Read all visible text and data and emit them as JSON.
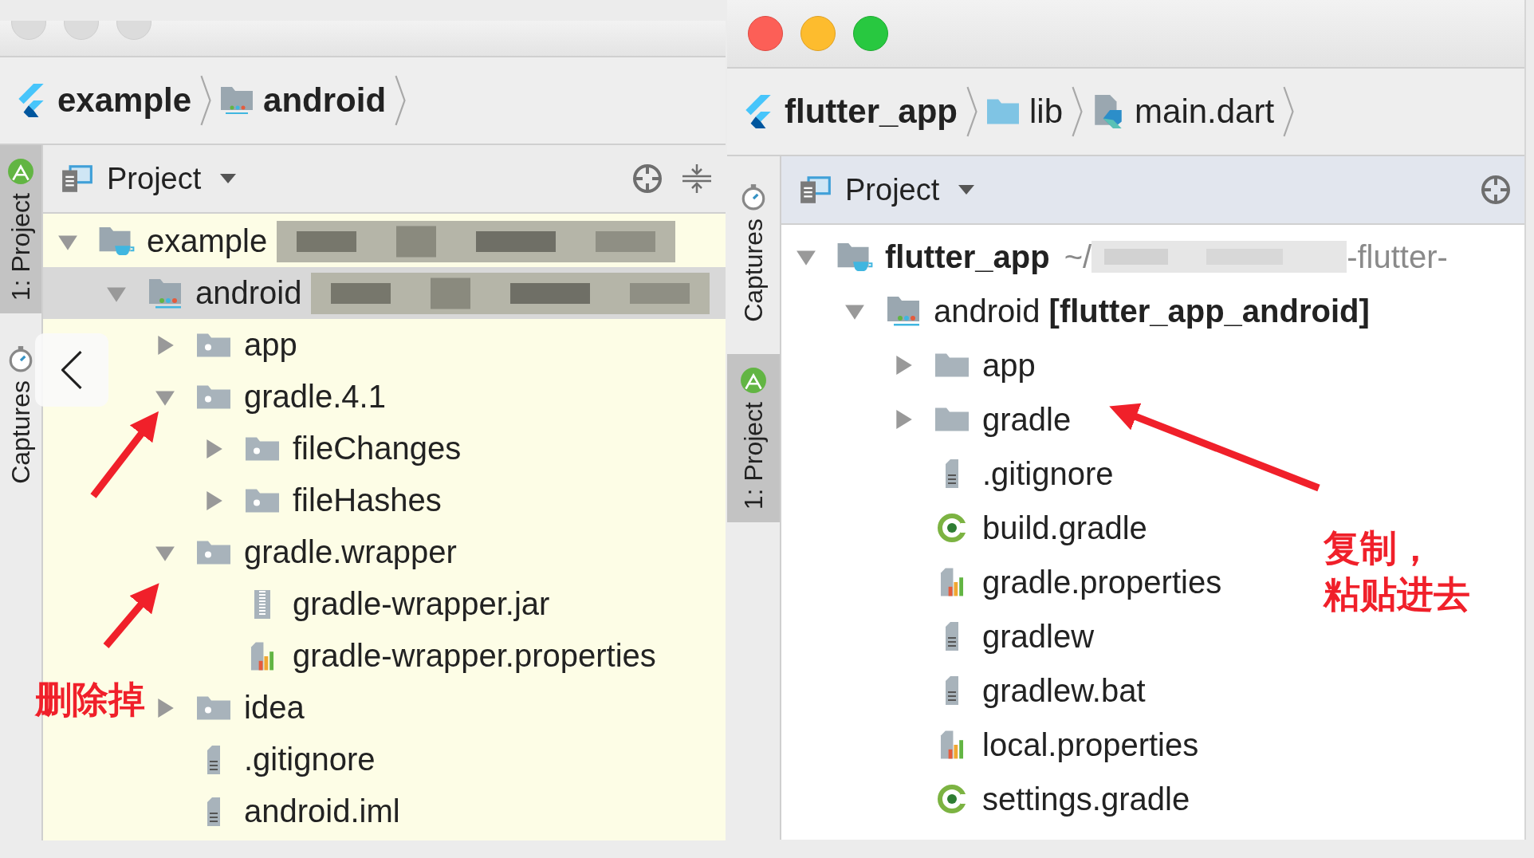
{
  "windows": [
    {
      "traffic_lights_active": false,
      "focused": false,
      "breadcrumbs": [
        {
          "label": "example",
          "kind": "flutter",
          "bold": true
        },
        {
          "label": "android",
          "kind": "module",
          "bold": true
        }
      ],
      "tool_tabs": [
        {
          "label": "1: Project",
          "kind": "android",
          "selected": true
        },
        {
          "label": "Captures",
          "kind": "captures",
          "selected": false
        }
      ],
      "panel": {
        "title": "Project",
        "tools": [
          {
            "kind": "locate"
          },
          {
            "kind": "collapse"
          }
        ]
      },
      "tree": [
        {
          "label": "example",
          "kind": "app-module",
          "redacted": true,
          "expanded": true,
          "selected": false,
          "children": [
            {
              "label": "android",
              "kind": "module",
              "redacted": true,
              "expanded": true,
              "selected": true,
              "children": [
                {
                  "label": "app",
                  "kind": "excluded-folder",
                  "expanded": false,
                  "selected": false
                },
                {
                  "label": "gradle.4.1",
                  "kind": "excluded-folder",
                  "expanded": true,
                  "selected": false,
                  "children": [
                    {
                      "label": "fileChanges",
                      "kind": "excluded-folder",
                      "expanded": false,
                      "selected": false
                    },
                    {
                      "label": "fileHashes",
                      "kind": "excluded-folder",
                      "expanded": false,
                      "selected": false
                    }
                  ]
                },
                {
                  "label": "gradle.wrapper",
                  "kind": "excluded-folder",
                  "expanded": true,
                  "selected": false,
                  "children": [
                    {
                      "label": "gradle-wrapper.jar",
                      "kind": "jar",
                      "selected": false
                    },
                    {
                      "label": "gradle-wrapper.properties",
                      "kind": "properties",
                      "selected": false
                    }
                  ]
                },
                {
                  "label": "idea",
                  "kind": "excluded-folder",
                  "expanded": false,
                  "selected": false
                },
                {
                  "label": ".gitignore",
                  "kind": "text",
                  "selected": false
                },
                {
                  "label": "android.iml",
                  "kind": "text",
                  "selected": false
                }
              ]
            }
          ]
        }
      ]
    },
    {
      "traffic_lights_active": true,
      "focused": true,
      "breadcrumbs": [
        {
          "label": "flutter_app",
          "kind": "flutter",
          "bold": true
        },
        {
          "label": "lib",
          "kind": "source",
          "bold": false
        },
        {
          "label": "main.dart",
          "kind": "dart",
          "bold": false
        }
      ],
      "tool_tabs": [
        {
          "label": "Captures",
          "kind": "captures",
          "selected": false
        },
        {
          "label": "1: Project",
          "kind": "android",
          "selected": true
        }
      ],
      "panel": {
        "title": "Project",
        "tools": [
          {
            "kind": "locate"
          }
        ]
      },
      "tree": [
        {
          "label": "flutter_app",
          "bold": true,
          "kind": "app-module",
          "path_start": "~/",
          "redacted": true,
          "path_end": "-flutter-",
          "expanded": true,
          "selected": false,
          "children": [
            {
              "label": "android **[flutter_app_android]**",
              "kind": "module",
              "expanded": true,
              "selected": false,
              "children": [
                {
                  "label": "app",
                  "kind": "folder",
                  "expanded": false,
                  "selected": false
                },
                {
                  "label": "gradle",
                  "kind": "folder",
                  "expanded": false,
                  "selected": false
                },
                {
                  "label": ".gitignore",
                  "kind": "text",
                  "selected": false
                },
                {
                  "label": "build.gradle",
                  "kind": "gradle",
                  "selected": false
                },
                {
                  "label": "gradle.properties",
                  "kind": "properties",
                  "selected": false
                },
                {
                  "label": "gradlew",
                  "kind": "text",
                  "selected": false
                },
                {
                  "label": "gradlew.bat",
                  "kind": "text",
                  "selected": false
                },
                {
                  "label": "local.properties",
                  "kind": "properties",
                  "selected": false
                },
                {
                  "label": "settings.gradle",
                  "kind": "gradle",
                  "selected": false
                }
              ]
            }
          ]
        }
      ]
    }
  ],
  "annotations": [
    "删除掉",
    "复制，",
    "粘贴进去"
  ]
}
